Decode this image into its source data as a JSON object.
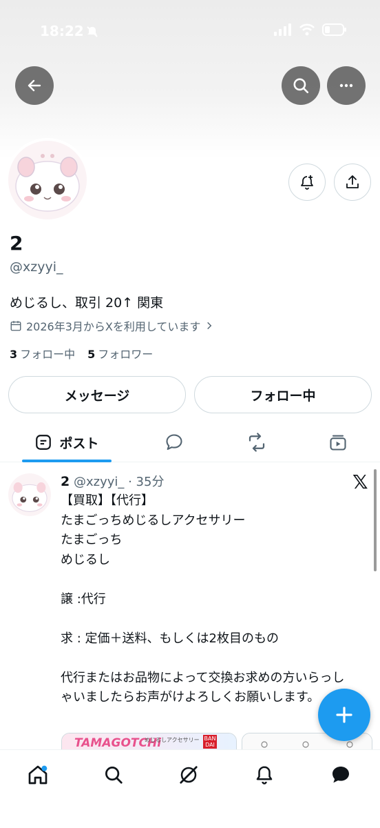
{
  "status_bar": {
    "time": "18:22"
  },
  "profile": {
    "name": "2",
    "handle": "@xzyyi_",
    "bio": "めじるし、取引 20↑ 関東",
    "joined": "2026年3月からXを利用しています",
    "following_count": "3",
    "following_label": "フォロー中",
    "followers_count": "5",
    "followers_label": "フォロワー"
  },
  "actions": {
    "message_label": "メッセージ",
    "following_button_label": "フォロー中"
  },
  "tabs": [
    {
      "label": "ポスト",
      "active": true
    },
    {
      "icon": "reply-icon"
    },
    {
      "icon": "repost-icon"
    },
    {
      "icon": "media-icon"
    }
  ],
  "post": {
    "author_name": "2",
    "author_handle": "@xzyyi_",
    "time": "· 35分",
    "text": "【買取】【代行】\nたまごっちめじるしアクセサリー\nたまごっち\nめじるし\n\n譲 :代行\n\n求 : 定価＋送料、もしくは2枚目のもの\n\n代行またはお品物によって交換お求めの方いらっしゃいましたらお声がけよろしくお願いします。",
    "media_logo_text": "TAMAGOTCHi",
    "media_caption": "めじるしアクセサリー",
    "media_brand": "BAN DAI"
  },
  "colors": {
    "accent": "#1d9bf0",
    "text": "#0f1419",
    "secondary": "#536471",
    "border": "#cfd9de"
  },
  "nav": [
    "home-icon",
    "search-icon",
    "grok-icon",
    "notifications-icon",
    "messages-icon"
  ]
}
